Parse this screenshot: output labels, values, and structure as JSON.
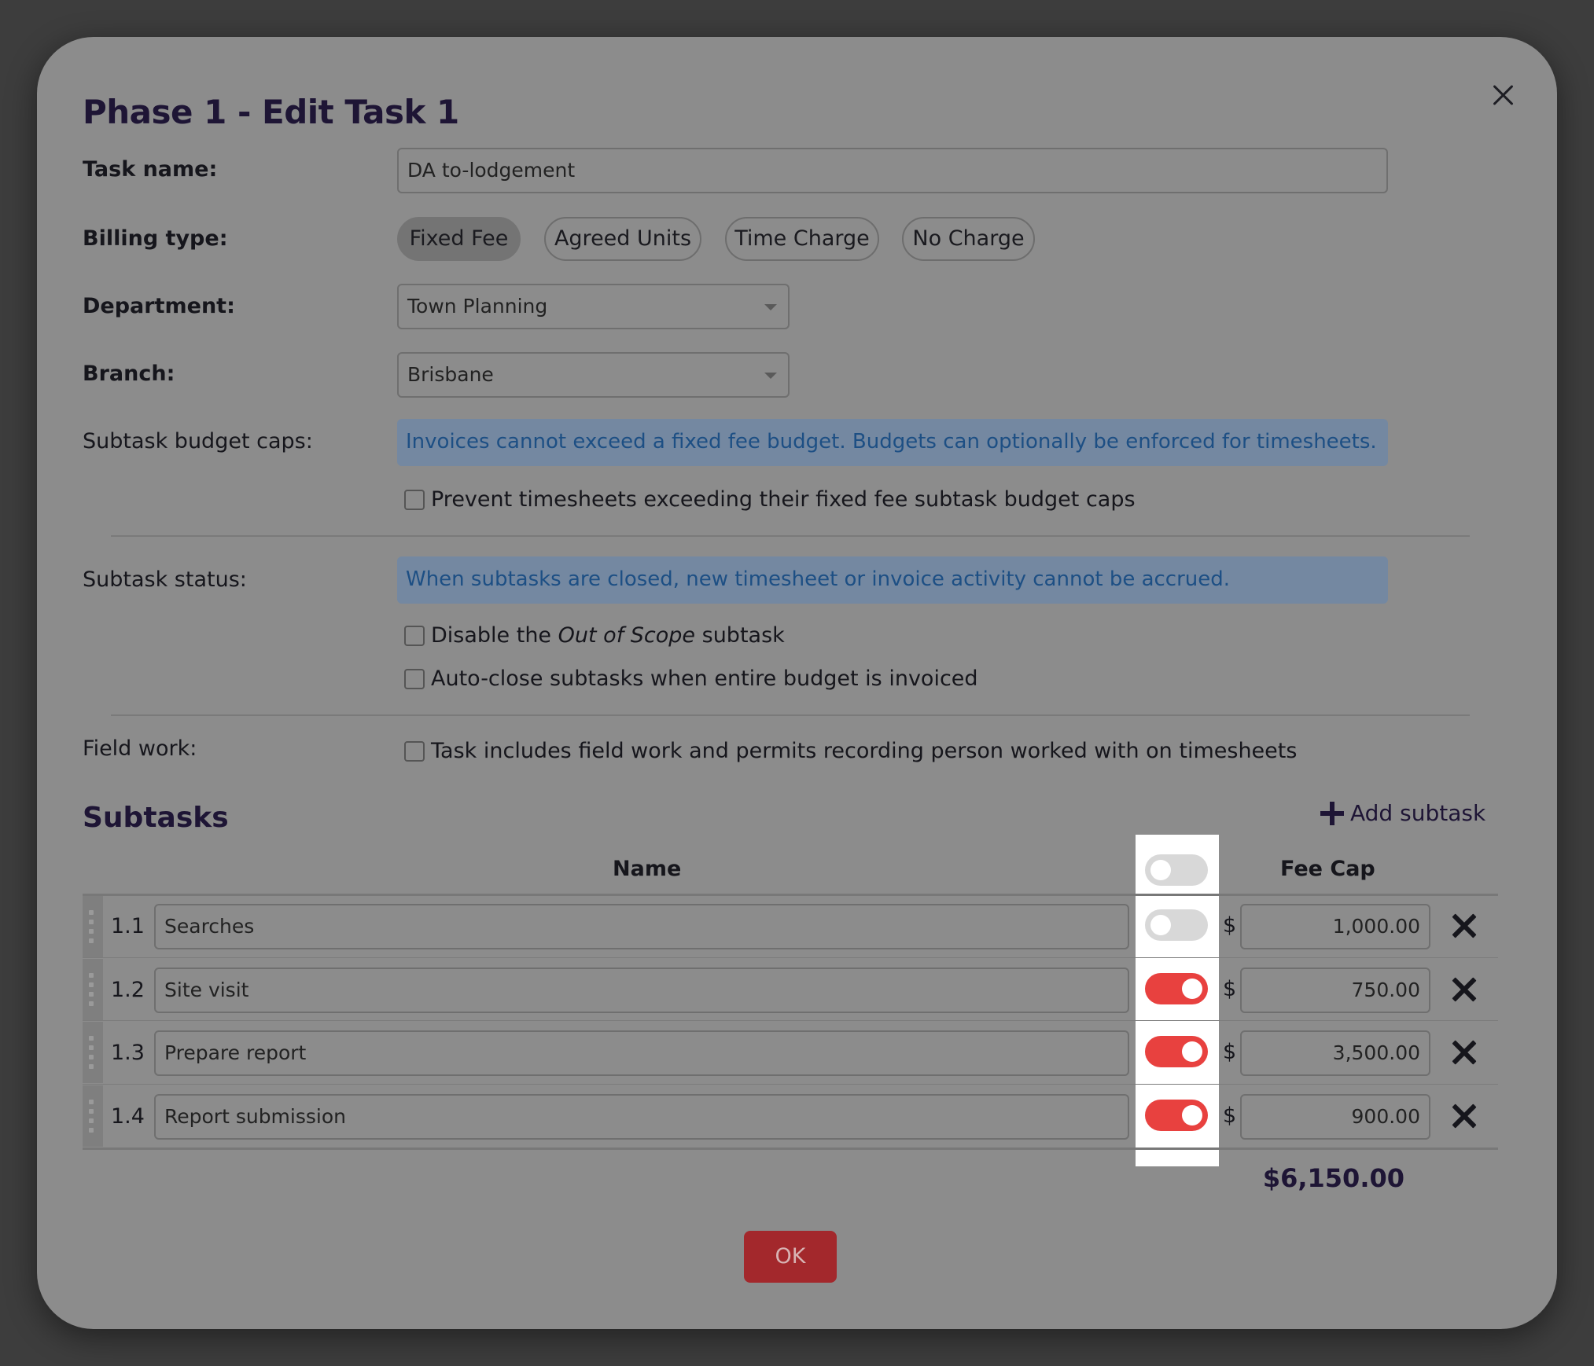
{
  "dialog": {
    "title": "Phase 1 - Edit Task 1",
    "close_icon": "close-icon"
  },
  "form": {
    "task_name": {
      "label": "Task name:",
      "value": "DA to-lodgement"
    },
    "billing_type": {
      "label": "Billing type:",
      "options": [
        "Fixed Fee",
        "Agreed Units",
        "Time Charge",
        "No Charge"
      ],
      "selected": "Fixed Fee"
    },
    "department": {
      "label": "Department:",
      "value": "Town Planning"
    },
    "branch": {
      "label": "Branch:",
      "value": "Brisbane"
    },
    "budget_caps": {
      "label": "Subtask budget caps:",
      "info": "Invoices cannot exceed a fixed fee budget. Budgets can optionally be enforced for timesheets.",
      "checkbox_label": "Prevent timesheets exceeding their fixed fee subtask budget caps",
      "checked": false
    },
    "subtask_status": {
      "label": "Subtask status:",
      "info": "When subtasks are closed, new timesheet or invoice activity cannot be accrued.",
      "disable_oos": {
        "prefix": "Disable the ",
        "emphasis": "Out of Scope",
        "suffix": " subtask",
        "checked": false
      },
      "auto_close": {
        "label": "Auto-close subtasks when entire budget is invoiced",
        "checked": false
      }
    },
    "field_work": {
      "label": "Field work:",
      "checkbox_label": "Task includes field work and permits recording person worked with on timesheets",
      "checked": false
    }
  },
  "subtasks": {
    "title": "Subtasks",
    "add_label": "Add subtask",
    "columns": {
      "name": "Name",
      "fee_cap": "Fee Cap"
    },
    "header_toggle": false,
    "currency_symbol": "$",
    "rows": [
      {
        "number": "1.1",
        "name": "Searches",
        "enabled": false,
        "fee": "1,000.00"
      },
      {
        "number": "1.2",
        "name": "Site visit",
        "enabled": true,
        "fee": "750.00"
      },
      {
        "number": "1.3",
        "name": "Prepare report",
        "enabled": true,
        "fee": "3,500.00"
      },
      {
        "number": "1.4",
        "name": "Report submission",
        "enabled": true,
        "fee": "900.00"
      }
    ],
    "total": "$6,150.00"
  },
  "footer": {
    "ok_label": "OK"
  },
  "colors": {
    "overlay": "#3d3d3d",
    "modal": "#8c8c8c",
    "toggle_on": "#e8413f",
    "ok_button": "#a3282c",
    "info_text": "#1d4f84"
  }
}
